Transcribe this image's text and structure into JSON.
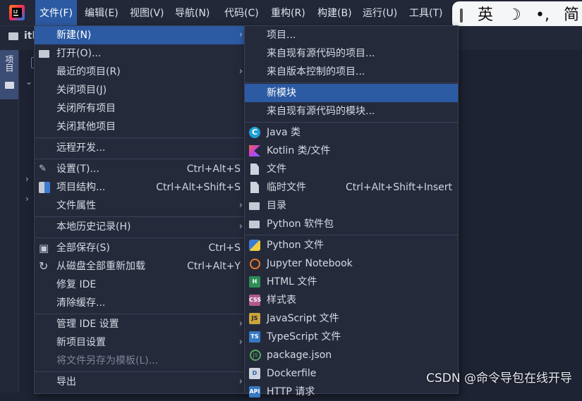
{
  "menubar": {
    "items": [
      {
        "label": "文件(F)",
        "active": true
      },
      {
        "label": "编辑(E)",
        "active": false
      },
      {
        "label": "视图(V)",
        "active": false
      },
      {
        "label": "导航(N)",
        "active": false
      },
      {
        "label": "代码(C)",
        "active": false
      },
      {
        "label": "重构(R)",
        "active": false
      },
      {
        "label": "构建(B)",
        "active": false
      },
      {
        "label": "运行(U)",
        "active": false
      },
      {
        "label": "工具(T)",
        "active": false
      }
    ]
  },
  "ime": {
    "lang": "英",
    "moon": "☽",
    "punct": "•,",
    "mode": "简"
  },
  "project": {
    "name": "itl",
    "tool_tab": "项目"
  },
  "file_menu": {
    "items": [
      {
        "label": "新建(N)",
        "shortcut": "",
        "submenu": true,
        "icon": "",
        "highlight": true,
        "disabled": false
      },
      {
        "label": "打开(O)...",
        "shortcut": "",
        "submenu": false,
        "icon": "folder-open-icon",
        "highlight": false,
        "disabled": false
      },
      {
        "label": "最近的项目(R)",
        "shortcut": "",
        "submenu": true,
        "icon": "",
        "highlight": false,
        "disabled": false
      },
      {
        "label": "关闭项目(J)",
        "shortcut": "",
        "submenu": false,
        "icon": "",
        "highlight": false,
        "disabled": false
      },
      {
        "label": "关闭所有项目",
        "shortcut": "",
        "submenu": false,
        "icon": "",
        "highlight": false,
        "disabled": false
      },
      {
        "label": "关闭其他项目",
        "shortcut": "",
        "submenu": false,
        "icon": "",
        "highlight": false,
        "disabled": false
      },
      {
        "separator": true
      },
      {
        "label": "远程开发...",
        "shortcut": "",
        "submenu": false,
        "icon": "",
        "highlight": false,
        "disabled": false
      },
      {
        "separator": true
      },
      {
        "label": "设置(T)...",
        "shortcut": "Ctrl+Alt+S",
        "submenu": false,
        "icon": "wrench-icon",
        "highlight": false,
        "disabled": false
      },
      {
        "label": "项目结构...",
        "shortcut": "Ctrl+Alt+Shift+S",
        "submenu": false,
        "icon": "project-structure-icon",
        "highlight": false,
        "disabled": false
      },
      {
        "label": "文件属性",
        "shortcut": "",
        "submenu": true,
        "icon": "",
        "highlight": false,
        "disabled": false
      },
      {
        "separator": true
      },
      {
        "label": "本地历史记录(H)",
        "shortcut": "",
        "submenu": true,
        "icon": "",
        "highlight": false,
        "disabled": false
      },
      {
        "separator": true
      },
      {
        "label": "全部保存(S)",
        "shortcut": "Ctrl+S",
        "submenu": false,
        "icon": "save-icon",
        "highlight": false,
        "disabled": false
      },
      {
        "label": "从磁盘全部重新加载",
        "shortcut": "Ctrl+Alt+Y",
        "submenu": false,
        "icon": "reload-icon",
        "highlight": false,
        "disabled": false
      },
      {
        "label": "修复 IDE",
        "shortcut": "",
        "submenu": false,
        "icon": "",
        "highlight": false,
        "disabled": false
      },
      {
        "label": "清除缓存...",
        "shortcut": "",
        "submenu": false,
        "icon": "",
        "highlight": false,
        "disabled": false
      },
      {
        "separator": true
      },
      {
        "label": "管理 IDE 设置",
        "shortcut": "",
        "submenu": true,
        "icon": "",
        "highlight": false,
        "disabled": false
      },
      {
        "label": "新项目设置",
        "shortcut": "",
        "submenu": true,
        "icon": "",
        "highlight": false,
        "disabled": false
      },
      {
        "label": "将文件另存为模板(L)...",
        "shortcut": "",
        "submenu": false,
        "icon": "",
        "highlight": false,
        "disabled": true
      },
      {
        "separator": true
      },
      {
        "label": "导出",
        "shortcut": "",
        "submenu": true,
        "icon": "",
        "highlight": false,
        "disabled": false
      }
    ]
  },
  "new_submenu": {
    "items": [
      {
        "label": "项目...",
        "shortcut": "",
        "icon": "",
        "highlight": false
      },
      {
        "label": "来自现有源代码的项目...",
        "shortcut": "",
        "icon": "",
        "highlight": false
      },
      {
        "label": "来自版本控制的项目...",
        "shortcut": "",
        "icon": "",
        "highlight": false
      },
      {
        "separator": true
      },
      {
        "label": "新模块",
        "shortcut": "",
        "icon": "",
        "highlight": true
      },
      {
        "label": "来自现有源代码的模块...",
        "shortcut": "",
        "icon": "",
        "highlight": false
      },
      {
        "separator": true
      },
      {
        "label": "Java 类",
        "shortcut": "",
        "icon": "java-class-icon",
        "highlight": false
      },
      {
        "label": "Kotlin 类/文件",
        "shortcut": "",
        "icon": "kotlin-icon",
        "highlight": false
      },
      {
        "label": "文件",
        "shortcut": "",
        "icon": "file-icon",
        "highlight": false
      },
      {
        "label": "临时文件",
        "shortcut": "Ctrl+Alt+Shift+Insert",
        "icon": "scratch-file-icon",
        "highlight": false
      },
      {
        "label": "目录",
        "shortcut": "",
        "icon": "folder-icon",
        "highlight": false
      },
      {
        "label": "Python 软件包",
        "shortcut": "",
        "icon": "python-package-icon",
        "highlight": false
      },
      {
        "separator": true
      },
      {
        "label": "Python 文件",
        "shortcut": "",
        "icon": "python-icon",
        "highlight": false
      },
      {
        "label": "Jupyter Notebook",
        "shortcut": "",
        "icon": "jupyter-icon",
        "highlight": false
      },
      {
        "label": "HTML 文件",
        "shortcut": "",
        "icon": "html-icon",
        "highlight": false
      },
      {
        "label": "样式表",
        "shortcut": "",
        "icon": "css-icon",
        "highlight": false
      },
      {
        "label": "JavaScript 文件",
        "shortcut": "",
        "icon": "javascript-icon",
        "highlight": false
      },
      {
        "label": "TypeScript 文件",
        "shortcut": "",
        "icon": "typescript-icon",
        "highlight": false
      },
      {
        "label": "package.json",
        "shortcut": "",
        "icon": "nodejs-icon",
        "highlight": false
      },
      {
        "label": "Dockerfile",
        "shortcut": "",
        "icon": "docker-icon",
        "highlight": false
      },
      {
        "label": "HTTP 请求",
        "shortcut": "",
        "icon": "http-icon",
        "highlight": false
      }
    ]
  },
  "icon_glyphs": {
    "java-class-icon": "C",
    "html-icon": "H",
    "css-icon": "CSS",
    "javascript-icon": "JS",
    "typescript-icon": "TS",
    "nodejs-icon": "js",
    "docker-icon": "D",
    "http-icon": "API",
    "reload-icon": "↻",
    "save-icon": "▣",
    "wrench-icon": "🔧"
  },
  "watermark": "CSDN @命令导包在线开导",
  "colors": {
    "highlight": "#2c5aa3",
    "menu_bg": "#252a3b",
    "app_bg": "#1e2333"
  }
}
